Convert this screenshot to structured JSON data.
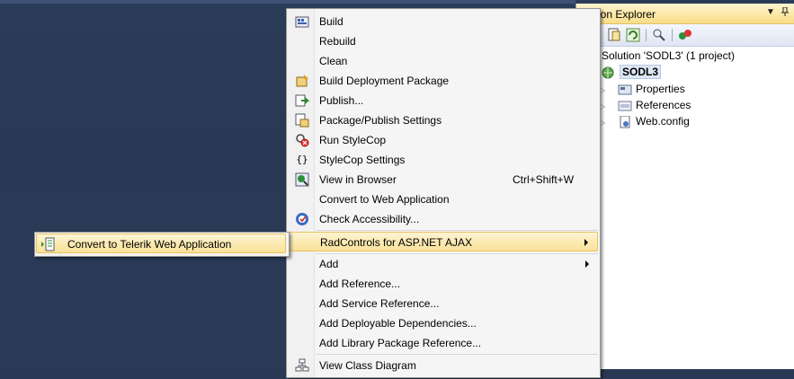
{
  "solution_explorer": {
    "title": "ion Explorer",
    "tree": {
      "solution": "Solution 'SODL3' (1 project)",
      "project": "SODL3",
      "items": [
        "Properties",
        "References",
        "Web.config"
      ]
    }
  },
  "context_menu": {
    "items": [
      {
        "label": "Build",
        "icon": "build-icon"
      },
      {
        "label": "Rebuild"
      },
      {
        "label": "Clean"
      },
      {
        "label": "Build Deployment Package",
        "icon": "package-icon"
      },
      {
        "label": "Publish...",
        "icon": "publish-icon"
      },
      {
        "label": "Package/Publish Settings",
        "icon": "settings-icon"
      },
      {
        "label": "Run StyleCop",
        "icon": "stylecop-icon"
      },
      {
        "label": "StyleCop Settings",
        "icon": "braces-icon"
      },
      {
        "label": "View in Browser",
        "shortcut": "Ctrl+Shift+W",
        "icon": "browser-icon"
      },
      {
        "label": "Convert to Web Application"
      },
      {
        "label": "Check Accessibility...",
        "icon": "accessibility-icon"
      },
      {
        "label": "RadControls for ASP.NET AJAX",
        "submenu": true,
        "highlighted": true
      },
      {
        "label": "Add",
        "submenu": true
      },
      {
        "label": "Add Reference..."
      },
      {
        "label": "Add Service Reference..."
      },
      {
        "label": "Add Deployable Dependencies..."
      },
      {
        "label": "Add Library Package Reference..."
      },
      {
        "label": "View Class Diagram",
        "icon": "class-diagram-icon"
      }
    ]
  },
  "submenu": {
    "items": [
      {
        "label": "Convert to Telerik Web Application",
        "icon": "telerik-convert-icon",
        "highlighted": true
      }
    ]
  },
  "colors": {
    "ide_background": "#293955",
    "highlight_border": "#e8c35f",
    "highlight_fill": "#fbe9b0"
  }
}
